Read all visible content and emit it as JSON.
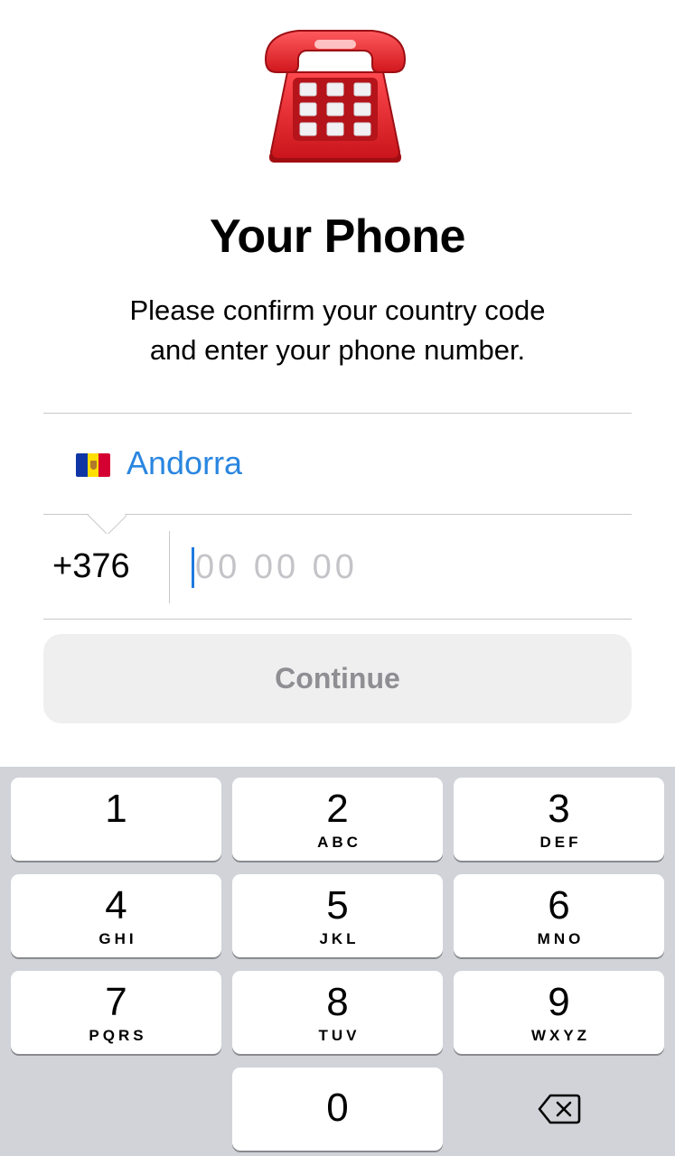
{
  "header": {
    "title": "Your Phone",
    "subtitle_line1": "Please confirm your country code",
    "subtitle_line2": "and enter your phone number."
  },
  "country": {
    "name": "Andorra",
    "flag_icon": "andorra-flag-icon"
  },
  "phone": {
    "code": "+376",
    "placeholder": "00 00 00",
    "value": ""
  },
  "continue_label": "Continue",
  "keypad": {
    "keys": [
      {
        "num": "1",
        "letters": ""
      },
      {
        "num": "2",
        "letters": "ABC"
      },
      {
        "num": "3",
        "letters": "DEF"
      },
      {
        "num": "4",
        "letters": "GHI"
      },
      {
        "num": "5",
        "letters": "JKL"
      },
      {
        "num": "6",
        "letters": "MNO"
      },
      {
        "num": "7",
        "letters": "PQRS"
      },
      {
        "num": "8",
        "letters": "TUV"
      },
      {
        "num": "9",
        "letters": "WXYZ"
      },
      {
        "num": "0",
        "letters": ""
      }
    ],
    "delete_icon": "backspace-icon"
  },
  "colors": {
    "accent": "#2a86e0",
    "phone_icon": "#e8262b",
    "button_disabled_bg": "#efeff0",
    "button_disabled_text": "#8e8e93",
    "keyboard_bg": "#d1d3d9"
  }
}
